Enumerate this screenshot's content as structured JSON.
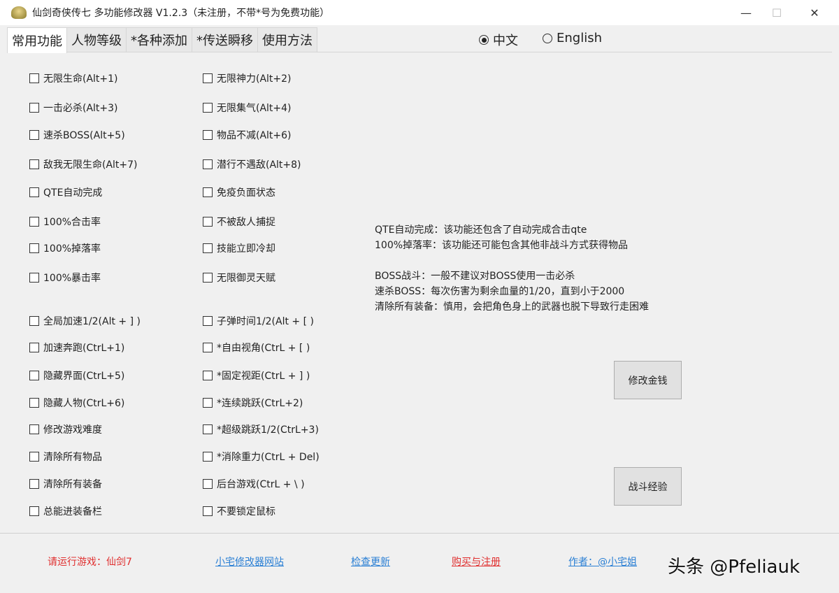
{
  "window": {
    "title": "仙剑奇侠传七 多功能修改器  V1.2.3（未注册，不带*号为免费功能）",
    "minimize": "—",
    "maximize": "☐",
    "close": "✕"
  },
  "tabs": [
    {
      "label": "常用功能",
      "active": true
    },
    {
      "label": "人物等级"
    },
    {
      "label": "*各种添加"
    },
    {
      "label": "*传送瞬移"
    },
    {
      "label": "使用方法"
    }
  ],
  "language": {
    "options": [
      {
        "label": "中文",
        "checked": true
      },
      {
        "label": "English",
        "checked": false
      }
    ]
  },
  "checkboxes_left": [
    "无限生命(Alt+1)",
    "一击必杀(Alt+3)",
    "速杀BOSS(Alt+5)",
    "敌我无限生命(Alt+7)",
    "QTE自动完成",
    "100%合击率",
    "100%掉落率",
    "100%暴击率",
    "全局加速1/2(Alt + ] )",
    "加速奔跑(CtrL+1)",
    "隐藏界面(CtrL+5)",
    "隐藏人物(CtrL+6)",
    "修改游戏难度",
    "清除所有物品",
    "清除所有装备",
    "总能进装备栏"
  ],
  "checkboxes_right": [
    "无限神力(Alt+2)",
    "无限集气(Alt+4)",
    "物品不减(Alt+6)",
    "潜行不遇敌(Alt+8)",
    "免疫负面状态",
    "不被敌人捕捉",
    "技能立即冷却",
    "无限御灵天赋",
    "子弹时间1/2(Alt + [ )",
    "*自由视角(CtrL + [ )",
    "*固定视距(CtrL + ] )",
    "*连续跳跃(CtrL+2)",
    "*超级跳跃1/2(CtrL+3)",
    "*消除重力(CtrL + Del)",
    "后台游戏(CtrL + \\ )",
    "不要锁定鼠标"
  ],
  "notes": "QTE自动完成：该功能还包含了自动完成合击qte\n100%掉落率：该功能还可能包含其他非战斗方式获得物品\n\nBOSS战斗：一般不建议对BOSS使用一击必杀\n速杀BOSS：每次伤害为剩余血量的1/20，直到小于2000\n清除所有装备：慎用，会把角色身上的武器也脱下导致行走困难",
  "buttons": {
    "money": "修改金钱",
    "exp": "战斗经验"
  },
  "footer": {
    "status": "请运行游戏：仙剑7",
    "site": "小宅修改器网站",
    "update": "检查更新",
    "register": "购买与注册",
    "author": "作者：@小宅姐"
  },
  "watermark": "头条 @Pfeliauk",
  "colors": {
    "red": "#e03030",
    "blue": "#2a7fd4"
  }
}
